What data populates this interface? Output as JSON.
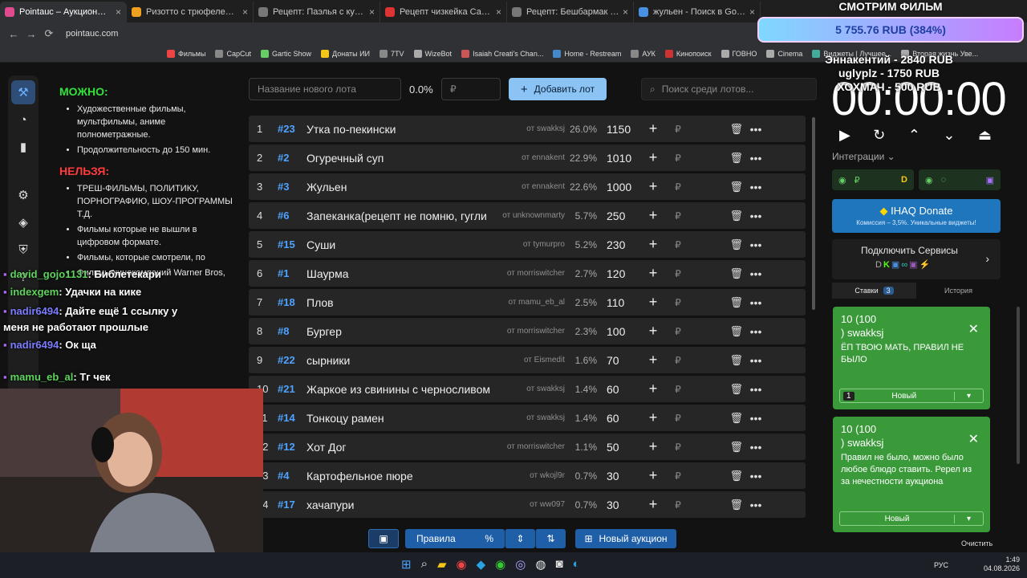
{
  "browser": {
    "tabs": [
      {
        "title": "Pointauc – Аукционы, лотереи",
        "color": "#e04a8e",
        "active": true
      },
      {
        "title": "Ризотто с трюфелем – рецепт",
        "color": "#f0a020",
        "active": false
      },
      {
        "title": "Рецепт: Паэлья с курицей и к",
        "color": "#777",
        "active": false
      },
      {
        "title": "Рецепт чизкейка Сан Себасть",
        "color": "#d33",
        "active": false
      },
      {
        "title": "Рецепт: Бешбармак на Russian",
        "color": "#777",
        "active": false
      },
      {
        "title": "жульен - Поиск в Google",
        "color": "#4a90e2",
        "active": false
      }
    ],
    "url": "pointauc.com",
    "bookmarks": [
      "Фильмы",
      "CapCut",
      "Gartic Show",
      "Донаты ИИ",
      "7TV",
      "WizeBot",
      "Isaiah Creati's Chan...",
      "Home - Restream",
      "АУК",
      "Кинопоиск",
      "ГОВНО",
      "Cinema",
      "Виджеты | Лучшее...",
      "Вторая жизнь Уве..."
    ]
  },
  "sidebar": {
    "icons": [
      "gavel-icon",
      "pie-chart-icon",
      "bar-chart-icon",
      "gear-icon",
      "layers-icon",
      "shield-icon",
      "help-icon"
    ]
  },
  "rules": {
    "allowed_title": "МОЖНО:",
    "allowed": [
      "Художественные фильмы, мультфильмы, аниме полнометражные.",
      "Продолжительность до 150 мин."
    ],
    "forbidden_title": "НЕЛЬЗЯ:",
    "forbidden": [
      "ТРЕШ-ФИЛЬМЫ, ПОЛИТИКУ, ПОРНОГРАФИЮ, ШОУ-ПРОГРАММЫ Т.Д.",
      "Фильмы которые не вышли в цифровом формате.",
      "Фильмы, которые смотрели, по",
      "Фильмы кинокомпаний Warner Bros,"
    ]
  },
  "toolbar": {
    "new_lot_placeholder": "Название нового лота",
    "percent": "0.0%",
    "amount_placeholder": "₽",
    "add_lot": "Добавить лот",
    "search_placeholder": "Поиск среди лотов..."
  },
  "lots": [
    {
      "idx": "1",
      "num": "#23",
      "name": "Утка по-пекински",
      "author": "от swakksj",
      "pct": "26.0%",
      "amount": "1150"
    },
    {
      "idx": "2",
      "num": "#2",
      "name": "Огуречный суп",
      "author": "от ennakent",
      "pct": "22.9%",
      "amount": "1010"
    },
    {
      "idx": "3",
      "num": "#3",
      "name": "Жульен",
      "author": "от ennakent",
      "pct": "22.6%",
      "amount": "1000"
    },
    {
      "idx": "4",
      "num": "#6",
      "name": "Запеканка(рецепт не помню, гугли",
      "author": "от unknownmarty",
      "pct": "5.7%",
      "amount": "250"
    },
    {
      "idx": "5",
      "num": "#15",
      "name": "Суши",
      "author": "от tymurpro",
      "pct": "5.2%",
      "amount": "230"
    },
    {
      "idx": "6",
      "num": "#1",
      "name": "Шаурма",
      "author": "от morriswitcher",
      "pct": "2.7%",
      "amount": "120"
    },
    {
      "idx": "7",
      "num": "#18",
      "name": "Плов",
      "author": "от mamu_eb_al",
      "pct": "2.5%",
      "amount": "110"
    },
    {
      "idx": "8",
      "num": "#8",
      "name": "Бургер",
      "author": "от morriswitcher",
      "pct": "2.3%",
      "amount": "100"
    },
    {
      "idx": "9",
      "num": "#22",
      "name": "сырники",
      "author": "от Eismedit",
      "pct": "1.6%",
      "amount": "70"
    },
    {
      "idx": "10",
      "num": "#21",
      "name": "Жаркое из свинины с черносливом и кр",
      "author": "от swakksj",
      "pct": "1.4%",
      "amount": "60"
    },
    {
      "idx": "11",
      "num": "#14",
      "name": "Тонкоцу рамен",
      "author": "от swakksj",
      "pct": "1.4%",
      "amount": "60"
    },
    {
      "idx": "12",
      "num": "#12",
      "name": "Хот Дог",
      "author": "от morriswitcher",
      "pct": "1.1%",
      "amount": "50"
    },
    {
      "idx": "13",
      "num": "#4",
      "name": "Картофельное пюре",
      "author": "от wkojl9r",
      "pct": "0.7%",
      "amount": "30"
    },
    {
      "idx": "14",
      "num": "#17",
      "name": "хачапури",
      "author": "от ww097",
      "pct": "0.7%",
      "amount": "30"
    }
  ],
  "bottom": {
    "rules": "Правила",
    "new_auction": "Новый аукцион"
  },
  "right": {
    "timer": "00:00:00",
    "integrations": "Интеграции",
    "ihaq_title": "IHAQ Donate",
    "ihaq_sub": "Комиссия – 3,5%. Уникальные виджеты!",
    "services": "Подключить Сервисы",
    "bids_tab": "Ставки",
    "bids_count": "3",
    "history_tab": "История",
    "bids": [
      {
        "head": "10 (100",
        "user": ") swakksj",
        "msg": "ЁП ТВОЮ МАТЬ, ПРАВИЛ НЕ БЫЛО",
        "badge": "1",
        "select": "Новый"
      },
      {
        "head": "10 (100",
        "user": ") swakksj",
        "msg": "Правил не было, можно было любое блюдо ставить. Ререл из за нечестности аукциона",
        "badge": "",
        "select": "Новый"
      }
    ],
    "clear": "Очистить"
  },
  "overlay": {
    "film_title": "СМОТРИМ ФИЛЬМ",
    "film_amount": "5 755.76 RUB (384%)",
    "top_donors": [
      "Эннакентий - 2840 RUB",
      "uglyplz - 1750 RUB",
      "ХОХМАЧ - 500 RUB"
    ]
  },
  "chat": [
    {
      "user": "david_gojo1131",
      "color": "#5ed35e",
      "msg": ": Библетекари"
    },
    {
      "user": "indexgem",
      "color": "#5ed35e",
      "msg": ": Удачки на кике"
    },
    {
      "user": "nadir6494",
      "color": "#7b7bff",
      "msg": ": Дайте ещё 1 ссылку у меня не работают прошлые"
    },
    {
      "user": "nadir6494",
      "color": "#7b7bff",
      "msg": ": Ок ща"
    },
    {
      "user": "mamu_eb_al",
      "color": "#5ed35e",
      "msg": ": Тг чек"
    }
  ],
  "taskbar": {
    "lang": "РУС",
    "time": "1:49",
    "date": "04.08.2026"
  }
}
